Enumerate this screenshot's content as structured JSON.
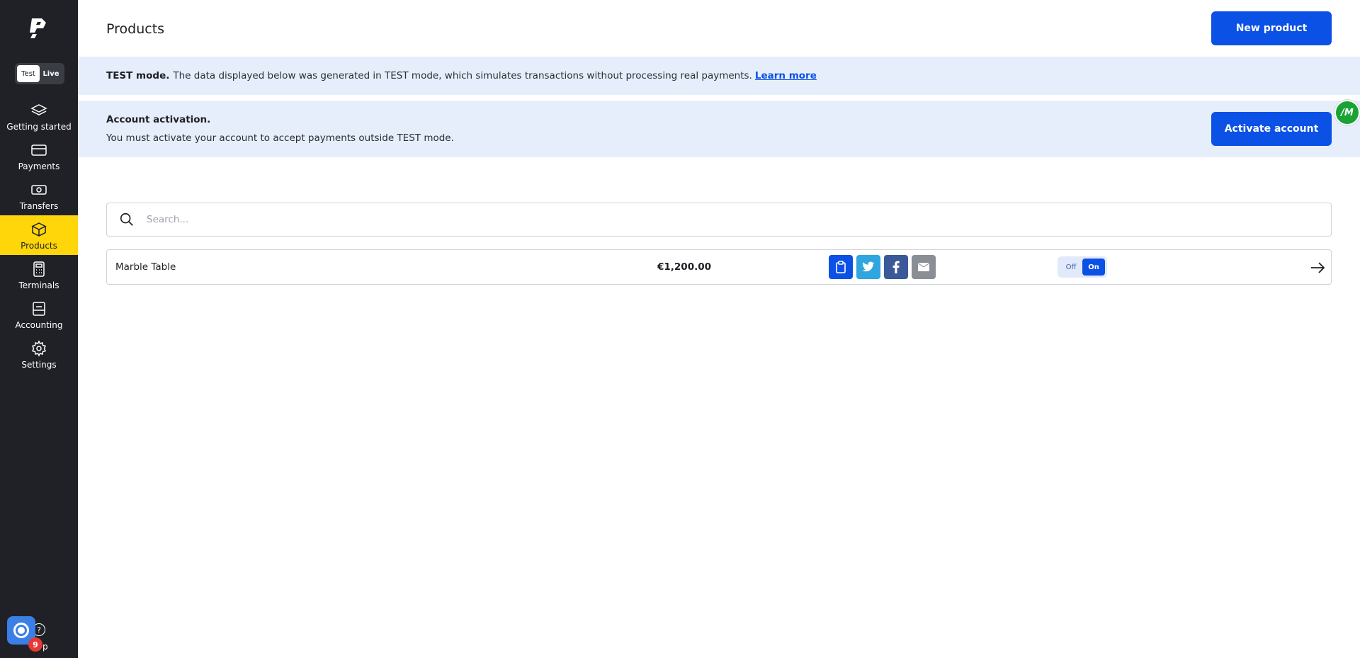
{
  "sidebar": {
    "mode_toggle": {
      "test_label": "Test",
      "live_label": "Live",
      "active": "Test"
    },
    "items": [
      {
        "label": "Getting started",
        "icon": "layers-icon"
      },
      {
        "label": "Payments",
        "icon": "card-icon"
      },
      {
        "label": "Transfers",
        "icon": "cash-icon"
      },
      {
        "label": "Products",
        "icon": "box-icon",
        "active": true
      },
      {
        "label": "Terminals",
        "icon": "calculator-icon"
      },
      {
        "label": "Accounting",
        "icon": "ledger-icon"
      },
      {
        "label": "Settings",
        "icon": "gear-icon"
      }
    ],
    "help": {
      "label": "p",
      "badge_count": "9"
    },
    "active_color": "#ffd60a"
  },
  "header": {
    "title": "Products",
    "new_product_label": "New product"
  },
  "test_banner": {
    "bold": "TEST mode.",
    "text": "The data displayed below was generated in TEST mode, which simulates transactions without processing real payments.",
    "link": "Learn more"
  },
  "activation_banner": {
    "title": "Account activation.",
    "text": "You must activate your account to accept payments outside TEST mode.",
    "button_label": "Activate account"
  },
  "avatar": {
    "initials": "M"
  },
  "search": {
    "placeholder": "Search...",
    "value": ""
  },
  "products": [
    {
      "name": "Marble Table",
      "price": "€1,200.00",
      "share": [
        "clipboard-icon",
        "twitter-icon",
        "facebook-icon",
        "mail-icon"
      ],
      "toggle": {
        "off_label": "Off",
        "on_label": "On",
        "state": "On"
      }
    }
  ],
  "colors": {
    "primary": "#0b51e5",
    "sidebar": "#1f2126",
    "banner": "#e6eefc"
  }
}
